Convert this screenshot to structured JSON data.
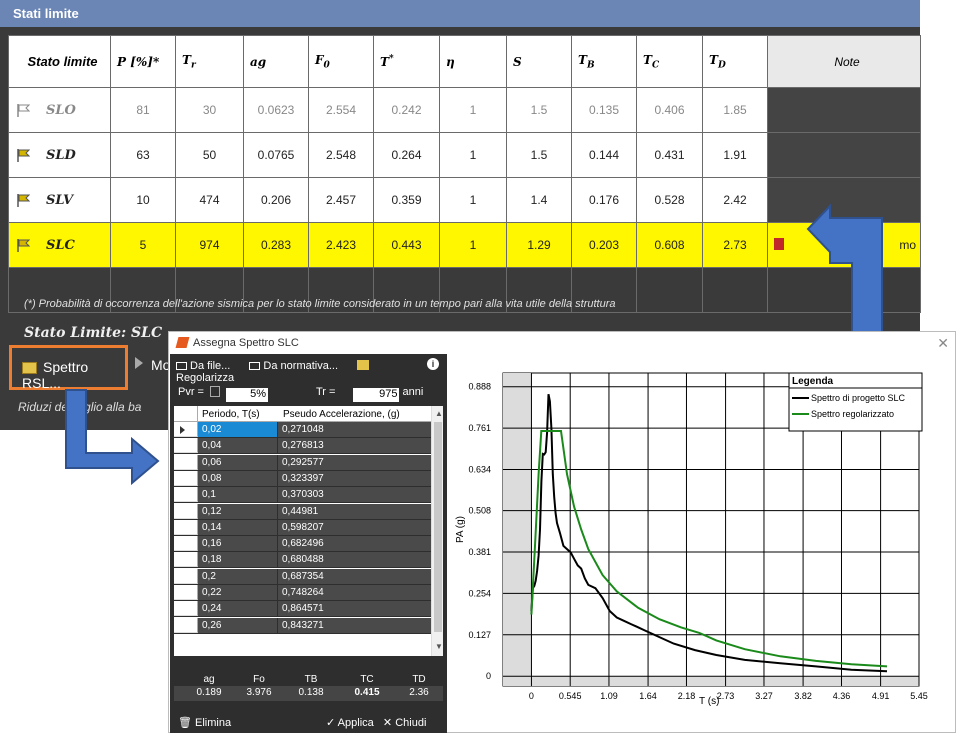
{
  "window": {
    "title": "Stati limite"
  },
  "table": {
    "headers": {
      "stato": "Stato limite",
      "p": "P [%]*",
      "tr": "T",
      "tr_sub": "r",
      "ag": "ag",
      "f0": "F",
      "f0_sub": "0",
      "tstar": "T",
      "tstar_sup": "*",
      "eta": "η",
      "s": "S",
      "tb": "T",
      "tb_sub": "B",
      "tc": "T",
      "tc_sub": "C",
      "td": "T",
      "td_sub": "D",
      "note": "Note"
    },
    "rows": [
      {
        "name": "SLO",
        "p": "81",
        "tr": "30",
        "ag": "0.0623",
        "f0": "2.554",
        "tstar": "0.242",
        "eta": "1",
        "s": "1.5",
        "tb": "0.135",
        "tc": "0.406",
        "td": "1.85",
        "note": ""
      },
      {
        "name": "SLD",
        "p": "63",
        "tr": "50",
        "ag": "0.0765",
        "f0": "2.548",
        "tstar": "0.264",
        "eta": "1",
        "s": "1.5",
        "tb": "0.144",
        "tc": "0.431",
        "td": "1.91",
        "note": ""
      },
      {
        "name": "SLV",
        "p": "10",
        "tr": "474",
        "ag": "0.206",
        "f0": "2.457",
        "tstar": "0.359",
        "eta": "1",
        "s": "1.4",
        "tb": "0.176",
        "tc": "0.528",
        "td": "2.42",
        "note": ""
      },
      {
        "name": "SLC",
        "p": "5",
        "tr": "974",
        "ag": "0.283",
        "f0": "2.423",
        "tstar": "0.443",
        "eta": "1",
        "s": "1.29",
        "tb": "0.203",
        "tc": "0.608",
        "td": "2.73",
        "note": "mo"
      }
    ],
    "footnote": "(*) Probabilità di occorrenza dell'azione sismica per lo stato limite considerato in un tempo pari alla vita utile della struttura"
  },
  "lower": {
    "stato_label": "Stato Limite: SLC",
    "spettro_button": "Spettro RSL...",
    "mo_label": "Mo",
    "riduzione_text": "Riduzi     del taglio alla ba"
  },
  "dialog": {
    "title": "Assegna Spettro SLC",
    "toolbar": {
      "da_file": "Da file...",
      "da_normativa": "Da normativa...",
      "regolarizza": "Regolarizza"
    },
    "pvr_label": "Pvr =",
    "pvr_value": "5%",
    "tr_label": "Tr =",
    "tr_value": "975",
    "tr_unit": "anni",
    "grid_headers": {
      "period": "Periodo, T(s)",
      "pa": "Pseudo Accelerazione, (g)"
    },
    "grid_rows": [
      [
        "0,02",
        "0,271048"
      ],
      [
        "0,04",
        "0,276813"
      ],
      [
        "0,06",
        "0,292577"
      ],
      [
        "0,08",
        "0,323397"
      ],
      [
        "0,1",
        "0,370303"
      ],
      [
        "0,12",
        "0,44981"
      ],
      [
        "0,14",
        "0,598207"
      ],
      [
        "0,16",
        "0,682496"
      ],
      [
        "0,18",
        "0,680488"
      ],
      [
        "0,2",
        "0,687354"
      ],
      [
        "0,22",
        "0,748264"
      ],
      [
        "0,24",
        "0,864571"
      ],
      [
        "0,26",
        "0,843271"
      ]
    ],
    "params": {
      "headers": [
        "ag",
        "Fo",
        "TB",
        "TC",
        "TD"
      ],
      "values": [
        "0.189",
        "3.976",
        "0.138",
        "0.415",
        "2.36"
      ]
    },
    "elimina": "Elimina",
    "applica": "Applica",
    "chiudi": "Chiudi"
  },
  "chart_data": {
    "type": "line",
    "xlabel": "T (s)",
    "ylabel": "PA (g)",
    "x_ticks": [
      "0",
      "0.545",
      "1.09",
      "1.64",
      "2.18",
      "2.73",
      "3.27",
      "3.82",
      "4.36",
      "4.91",
      "5.45"
    ],
    "y_ticks": [
      "0",
      "0.127",
      "0.254",
      "0.381",
      "0.508",
      "0.634",
      "0.761",
      "0.888"
    ],
    "xlim": [
      -0.4,
      5.45
    ],
    "ylim": [
      -0.03,
      0.93
    ],
    "legend": {
      "title": "Legenda",
      "placement": "top-right"
    },
    "colors": {
      "progetto": "#000000",
      "regolarizzato": "#1a8a1a"
    },
    "series": [
      {
        "name": "Spettro di progetto  SLC",
        "x": [
          0,
          0.02,
          0.04,
          0.06,
          0.08,
          0.1,
          0.12,
          0.14,
          0.16,
          0.18,
          0.2,
          0.22,
          0.24,
          0.26,
          0.28,
          0.3,
          0.32,
          0.34,
          0.36,
          0.4,
          0.45,
          0.5,
          0.55,
          0.6,
          0.65,
          0.7,
          0.75,
          0.8,
          0.9,
          1.0,
          1.1,
          1.2,
          1.3,
          1.4,
          1.5,
          1.6,
          1.8,
          2.0,
          2.3,
          2.6,
          3.0,
          3.5,
          4.0,
          4.5,
          5.0
        ],
        "y": [
          0.2,
          0.271,
          0.277,
          0.293,
          0.323,
          0.37,
          0.45,
          0.598,
          0.682,
          0.68,
          0.687,
          0.748,
          0.865,
          0.843,
          0.76,
          0.62,
          0.55,
          0.5,
          0.47,
          0.44,
          0.4,
          0.39,
          0.38,
          0.36,
          0.34,
          0.33,
          0.3,
          0.28,
          0.27,
          0.24,
          0.2,
          0.18,
          0.17,
          0.16,
          0.15,
          0.14,
          0.12,
          0.1,
          0.08,
          0.065,
          0.05,
          0.04,
          0.03,
          0.02,
          0.015
        ]
      },
      {
        "name": "Spettro regolarizzato",
        "x": [
          0,
          0.05,
          0.1,
          0.138,
          0.2,
          0.3,
          0.415,
          0.5,
          0.6,
          0.7,
          0.8,
          1.0,
          1.2,
          1.5,
          1.8,
          2.1,
          2.36,
          2.6,
          3.0,
          3.5,
          4.0,
          4.5,
          5.0
        ],
        "y": [
          0.189,
          0.4,
          0.62,
          0.752,
          0.752,
          0.752,
          0.752,
          0.62,
          0.52,
          0.45,
          0.39,
          0.31,
          0.26,
          0.21,
          0.175,
          0.15,
          0.133,
          0.11,
          0.083,
          0.061,
          0.047,
          0.037,
          0.03
        ]
      }
    ]
  }
}
